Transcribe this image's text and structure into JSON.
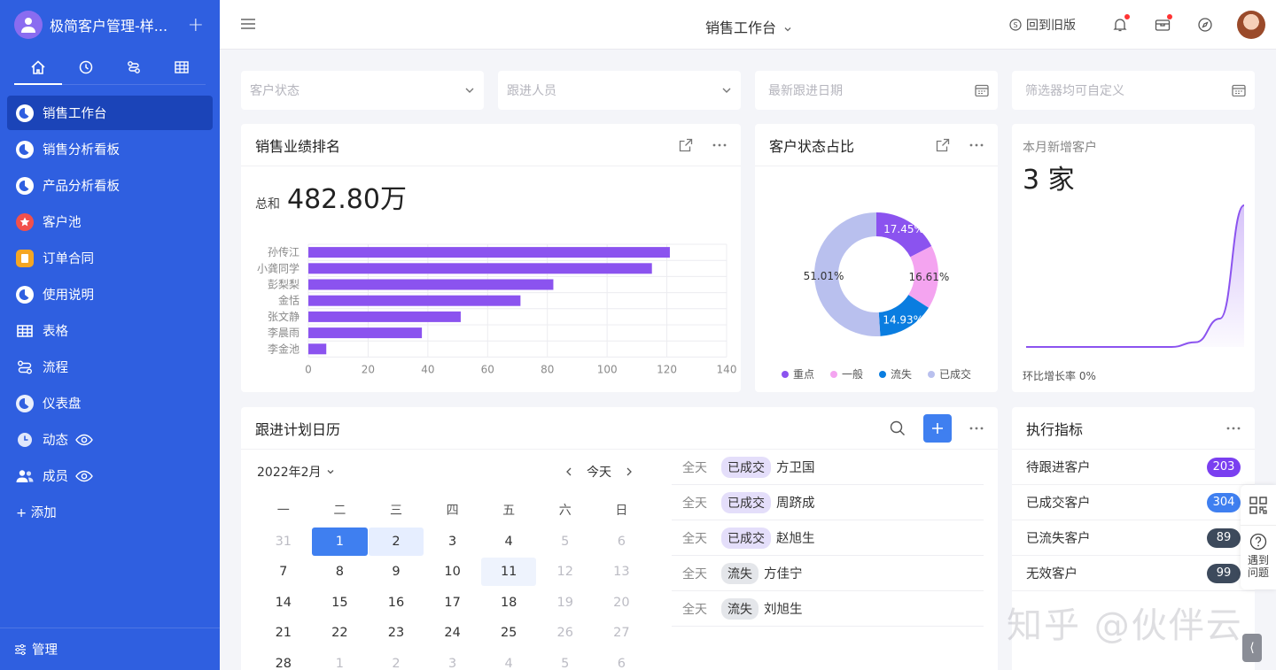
{
  "app": {
    "title": "极简客户管理-样..."
  },
  "sidebar": {
    "tabs": [
      "home-icon",
      "clock-icon",
      "flow-icon",
      "table-icon"
    ],
    "items": [
      {
        "label": "销售工作台",
        "icon": "pie-icon",
        "color": "#ffffff"
      },
      {
        "label": "销售分析看板",
        "icon": "pie-icon",
        "color": "#ffffff"
      },
      {
        "label": "产品分析看板",
        "icon": "pie-icon",
        "color": "#ffffff"
      },
      {
        "label": "客户池",
        "icon": "star-icon",
        "color": "#f2504b"
      },
      {
        "label": "订单合同",
        "icon": "doc-icon",
        "color": "#f5a623"
      },
      {
        "label": "使用说明",
        "icon": "pie-icon",
        "color": "#ffffff"
      },
      {
        "label": "表格",
        "icon": "grid-icon"
      },
      {
        "label": "流程",
        "icon": "flow-icon"
      },
      {
        "label": "仪表盘",
        "icon": "pie-icon"
      },
      {
        "label": "动态",
        "icon": "clock-icon"
      },
      {
        "label": "成员",
        "icon": "users-icon"
      }
    ],
    "add_label": "+ 添加",
    "manage_label": "管理"
  },
  "topbar": {
    "title": "销售工作台",
    "back_label": "回到旧版"
  },
  "filters": [
    {
      "placeholder": "客户状态",
      "icon": "chevron-down-icon"
    },
    {
      "placeholder": "跟进人员",
      "icon": "chevron-down-icon"
    },
    {
      "placeholder": "最新跟进日期",
      "icon": "calendar-icon"
    },
    {
      "placeholder": "筛选器均可自定义",
      "icon": "calendar-icon"
    }
  ],
  "ranking": {
    "title": "销售业绩排名",
    "total_label": "总和",
    "total_value": "482.80万"
  },
  "status_card": {
    "title": "客户状态占比"
  },
  "new_customers": {
    "title": "本月新增客户",
    "value": "3 家",
    "growth_label": "环比增长率 0%"
  },
  "calendar": {
    "title": "跟进计划日历",
    "month_label": "2022年2月",
    "today_label": "今天",
    "weekdays": [
      "一",
      "二",
      "三",
      "四",
      "五",
      "六",
      "日"
    ],
    "weeks": [
      [
        "31",
        "1",
        "2",
        "3",
        "4",
        "5",
        "6"
      ],
      [
        "7",
        "8",
        "9",
        "10",
        "11",
        "12",
        "13"
      ],
      [
        "14",
        "15",
        "16",
        "17",
        "18",
        "19",
        "20"
      ],
      [
        "21",
        "22",
        "23",
        "24",
        "25",
        "26",
        "27"
      ],
      [
        "28",
        "1",
        "2",
        "3",
        "4",
        "5",
        "6"
      ]
    ],
    "selected_day": "1",
    "events": [
      {
        "time": "全天",
        "tag": "已成交",
        "name": "方卫国"
      },
      {
        "time": "全天",
        "tag": "已成交",
        "name": "周跻成"
      },
      {
        "time": "全天",
        "tag": "已成交",
        "name": "赵旭生"
      },
      {
        "time": "全天",
        "tag": "流失",
        "name": "方佳宁"
      },
      {
        "time": "全天",
        "tag": "流失",
        "name": "刘旭生"
      }
    ]
  },
  "kpis": {
    "title": "执行指标",
    "items": [
      {
        "label": "待跟进客户",
        "value": "203",
        "color": "#7a3ff0"
      },
      {
        "label": "已成交客户",
        "value": "304",
        "color": "#3f7ff0"
      },
      {
        "label": "已流失客户",
        "value": "89",
        "color": "#3d4a5c"
      },
      {
        "label": "无效客户",
        "value": "99",
        "color": "#3d4a5c"
      }
    ]
  },
  "float_bar": {
    "help_label": "遇到问题"
  },
  "watermark": "知乎 @伙伴云",
  "chart_data": [
    {
      "type": "bar",
      "orientation": "horizontal",
      "categories": [
        "孙传江",
        "小龚同学",
        "彭梨梨",
        "金恬",
        "张文静",
        "李晨雨",
        "李金池"
      ],
      "values": [
        121,
        115,
        82,
        71,
        51,
        38,
        6
      ],
      "xlim": [
        0,
        140
      ],
      "xticks": [
        "0",
        "20",
        "40",
        "60",
        "80",
        "100",
        "120",
        "140"
      ],
      "color": "#8b53ef",
      "grid": true
    },
    {
      "type": "pie",
      "donut": true,
      "labels": [
        "重点",
        "一般",
        "流失",
        "已成交"
      ],
      "values": [
        17.45,
        16.61,
        14.93,
        51.01
      ],
      "value_labels": [
        "17.45%",
        "16.61%",
        "14.93%",
        "51.01%"
      ],
      "colors": [
        "#8b53ef",
        "#f4a4f0",
        "#0a7de0",
        "#b9c0ee"
      ],
      "legend": "bottom"
    },
    {
      "type": "area",
      "x": [
        1,
        2,
        3,
        4,
        5,
        6,
        7,
        8,
        9,
        10
      ],
      "values": [
        0,
        0,
        0,
        0,
        0,
        0,
        0,
        0.1,
        0.6,
        3
      ],
      "color": "#8b53ef",
      "axes": false
    }
  ]
}
